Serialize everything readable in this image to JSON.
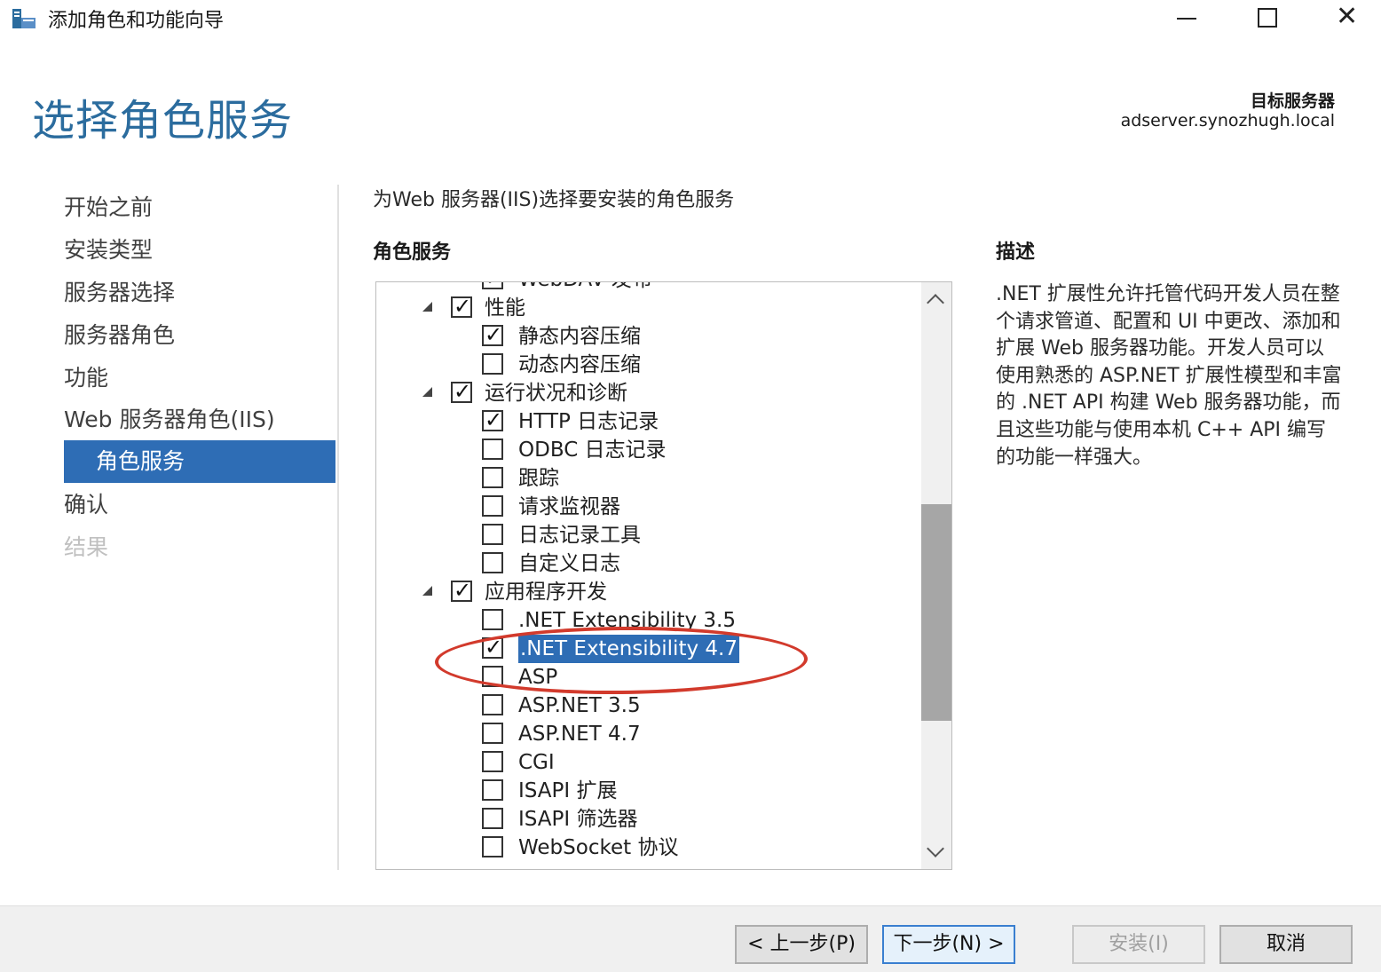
{
  "window": {
    "title": "添加角色和功能向导",
    "close_glyph": "✕"
  },
  "header": {
    "page_title": "选择角色服务",
    "target_label": "目标服务器",
    "target_server": "adserver.synozhugh.local"
  },
  "nav": {
    "items": [
      {
        "label": "开始之前",
        "state": "normal"
      },
      {
        "label": "安装类型",
        "state": "normal"
      },
      {
        "label": "服务器选择",
        "state": "normal"
      },
      {
        "label": "服务器角色",
        "state": "normal"
      },
      {
        "label": "功能",
        "state": "normal"
      },
      {
        "label": "Web 服务器角色(IIS)",
        "state": "normal"
      },
      {
        "label": "角色服务",
        "state": "active"
      },
      {
        "label": "确认",
        "state": "normal"
      },
      {
        "label": "结果",
        "state": "disabled"
      }
    ]
  },
  "main": {
    "instruction": "为Web 服务器(IIS)选择要安装的角色服务",
    "role_services_header": "角色服务",
    "description_header": "描述",
    "description_text": ".NET 扩展性允许托管代码开发人员在整个请求管道、配置和 UI 中更改、添加和扩展 Web 服务器功能。开发人员可以使用熟悉的 ASP.NET 扩展性模型和丰富的 .NET API 构建 Web 服务器功能，而且这些功能与使用本机 C++ API 编写的功能一样强大。"
  },
  "tree": {
    "check_glyph": "✓",
    "items": [
      {
        "label": "WebDAV 发布",
        "level": 2,
        "checked": true,
        "expandable": false
      },
      {
        "label": "性能",
        "level": 1,
        "checked": true,
        "expandable": true
      },
      {
        "label": "静态内容压缩",
        "level": 2,
        "checked": true,
        "expandable": false
      },
      {
        "label": "动态内容压缩",
        "level": 2,
        "checked": false,
        "expandable": false
      },
      {
        "label": "运行状况和诊断",
        "level": 1,
        "checked": true,
        "expandable": true
      },
      {
        "label": "HTTP 日志记录",
        "level": 2,
        "checked": true,
        "expandable": false
      },
      {
        "label": "ODBC 日志记录",
        "level": 2,
        "checked": false,
        "expandable": false
      },
      {
        "label": "跟踪",
        "level": 2,
        "checked": false,
        "expandable": false
      },
      {
        "label": "请求监视器",
        "level": 2,
        "checked": false,
        "expandable": false
      },
      {
        "label": "日志记录工具",
        "level": 2,
        "checked": false,
        "expandable": false
      },
      {
        "label": "自定义日志",
        "level": 2,
        "checked": false,
        "expandable": false
      },
      {
        "label": "应用程序开发",
        "level": 1,
        "checked": true,
        "expandable": true
      },
      {
        "label": ".NET Extensibility 3.5",
        "level": 2,
        "checked": false,
        "expandable": false
      },
      {
        "label": ".NET Extensibility 4.7",
        "level": 2,
        "checked": true,
        "expandable": false,
        "selected": true
      },
      {
        "label": "ASP",
        "level": 2,
        "checked": false,
        "expandable": false
      },
      {
        "label": "ASP.NET 3.5",
        "level": 2,
        "checked": false,
        "expandable": false
      },
      {
        "label": "ASP.NET 4.7",
        "level": 2,
        "checked": false,
        "expandable": false
      },
      {
        "label": "CGI",
        "level": 2,
        "checked": false,
        "expandable": false
      },
      {
        "label": "ISAPI 扩展",
        "level": 2,
        "checked": false,
        "expandable": false
      },
      {
        "label": "ISAPI 筛选器",
        "level": 2,
        "checked": false,
        "expandable": false
      },
      {
        "label": "WebSocket 协议",
        "level": 2,
        "checked": false,
        "expandable": false
      }
    ]
  },
  "buttons": {
    "prev": "< 上一步(P)",
    "next": "下一步(N) >",
    "install": "安装(I)",
    "cancel": "取消"
  },
  "colors": {
    "accent": "#2e6db5",
    "title": "#2b6c9e",
    "annotation": "#d23a2c"
  }
}
